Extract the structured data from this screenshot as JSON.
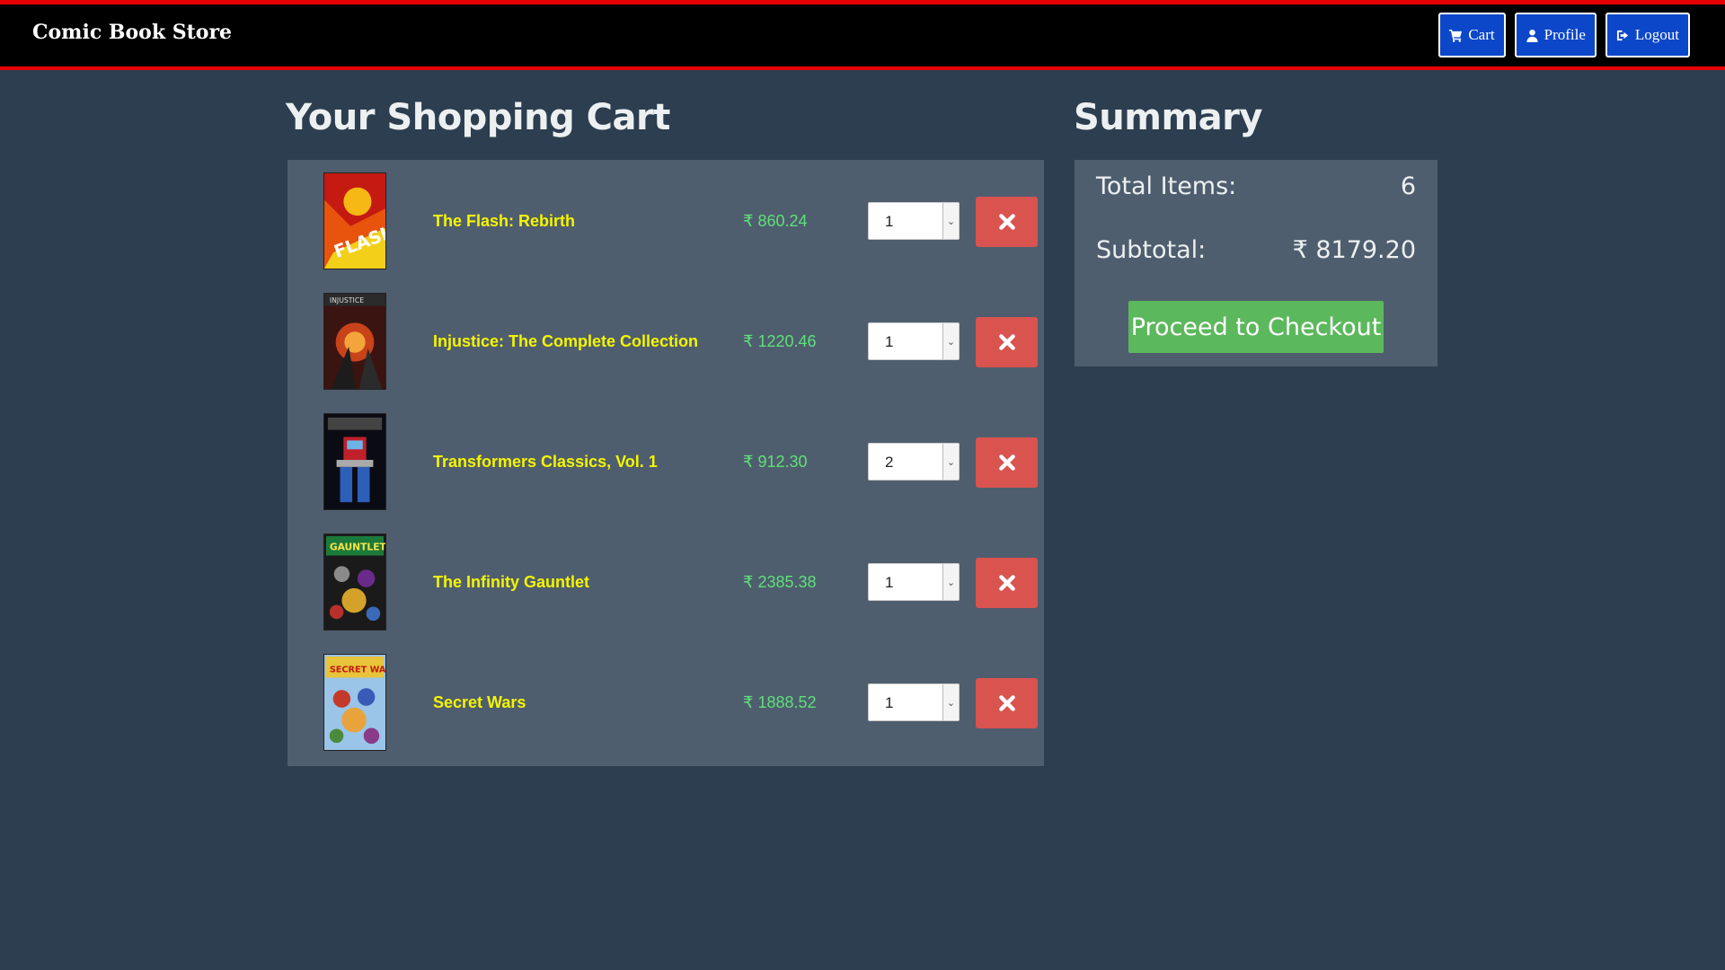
{
  "navbar": {
    "brand": "Comic Book Store",
    "buttons": [
      {
        "label": "Cart",
        "icon": "cart-icon"
      },
      {
        "label": "Profile",
        "icon": "user-icon"
      },
      {
        "label": "Logout",
        "icon": "logout-icon"
      }
    ]
  },
  "cart": {
    "heading": "Your Shopping Cart",
    "items": [
      {
        "title": "The Flash: Rebirth",
        "price": "₹ 860.24",
        "quantity": "1"
      },
      {
        "title": "Injustice: The Complete Collection",
        "price": "₹ 1220.46",
        "quantity": "1"
      },
      {
        "title": "Transformers Classics, Vol. 1",
        "price": "₹ 912.30",
        "quantity": "2"
      },
      {
        "title": "The Infinity Gauntlet",
        "price": "₹ 2385.38",
        "quantity": "1"
      },
      {
        "title": "Secret Wars",
        "price": "₹ 1888.52",
        "quantity": "1"
      }
    ]
  },
  "summary": {
    "heading": "Summary",
    "total_items_label": "Total Items:",
    "total_items_value": "6",
    "subtotal_label": "Subtotal:",
    "subtotal_value": "₹ 8179.20",
    "checkout_label": "Proceed to Checkout"
  },
  "colors": {
    "background": "#2c3e50",
    "panel": "#4f5e6e",
    "nav_accent": "#e50000",
    "nav_button": "#0d47c9",
    "title_text": "#f5f500",
    "price_text": "#5ee07a",
    "remove_button": "#d9534f",
    "checkout_button": "#5cb85c"
  }
}
